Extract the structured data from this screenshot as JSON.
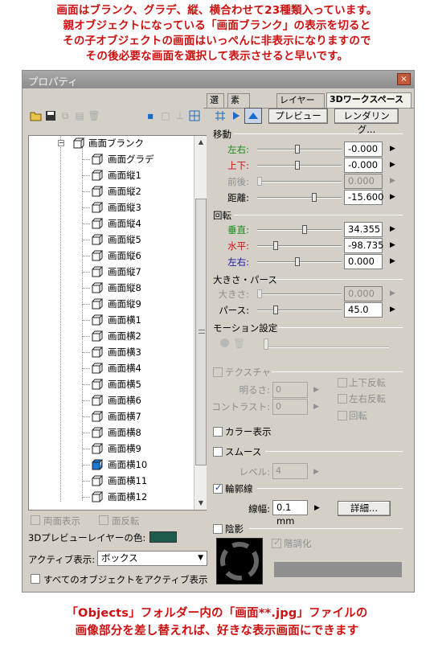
{
  "captions": {
    "top": [
      "画面はブランク、グラデ、縦、横合わせて23種類入っています。",
      "親オブジェクトになっている「画面ブランク」の表示を切ると",
      "その子オブジェクトの画面はいっぺんに非表示になりますので",
      "その後必要な画面を選択して表示させると早いです。"
    ],
    "bottom": [
      "「Objects」フォルダー内の「画面**.jpg」ファイルの",
      "画像部分を差し替えれば、好きな表示画面にできます"
    ]
  },
  "window": {
    "title": "プロパティ",
    "close": "×"
  },
  "tabs": {
    "t1": "選",
    "t2": "素",
    "t3": "レイヤー",
    "t4": "3Dワークスペース"
  },
  "buttons": {
    "preview": "プレビュー",
    "rendering": "レンダリング...",
    "detail": "詳細..."
  },
  "tree": {
    "parent": "画面ブランク",
    "items": [
      "画面グラデ",
      "画面縦1",
      "画面縦2",
      "画面縦3",
      "画面縦4",
      "画面縦5",
      "画面縦6",
      "画面縦7",
      "画面縦8",
      "画面縦9",
      "画面横1",
      "画面横2",
      "画面横3",
      "画面横4",
      "画面横5",
      "画面横6",
      "画面横7",
      "画面横8",
      "画面横9",
      "画面横10",
      "画面横11",
      "画面横12"
    ],
    "selected_index": 19
  },
  "left_bottom": {
    "double_sided": "両面表示",
    "face_flip": "面反転",
    "layer_color_label": "3Dプレビューレイヤーの色:",
    "layer_color": "#1d5a4a",
    "active_display_label": "アクティブ表示:",
    "active_display_value": "ボックス",
    "all_active": "すべてのオブジェクトをアクティブ表示"
  },
  "move": {
    "title": "移動",
    "x_label": "左右:",
    "x_value": "-0.000",
    "y_label": "上下:",
    "y_value": "-0.000",
    "z_label": "前後:",
    "z_value": "0.000",
    "dist_label": "距離:",
    "dist_value": "-15.600"
  },
  "rotate": {
    "title": "回転",
    "v_label": "垂直:",
    "v_value": "34.355",
    "h_label": "水平:",
    "h_value": "-98.735",
    "r_label": "左右:",
    "r_value": "0.000"
  },
  "size": {
    "title": "大きさ・パース",
    "size_label": "大きさ:",
    "size_value": "0.000",
    "pers_label": "パース:",
    "pers_value": "45.0"
  },
  "motion": {
    "title": "モーション設定"
  },
  "texture": {
    "title": "テクスチャ",
    "bright_label": "明るさ:",
    "bright_value": "0",
    "contrast_label": "コントラスト:",
    "contrast_value": "0",
    "flip_v": "上下反転",
    "flip_h": "左右反転",
    "rotate": "回転"
  },
  "cartoon": "カラー表示",
  "smooth": {
    "title": "スムース",
    "level_label": "レベル:",
    "level_value": "4"
  },
  "outline": {
    "title": "輪郭線",
    "width_label": "線幅:",
    "width_value": "0.1 mm"
  },
  "shadow": {
    "title": "陰影",
    "tone": "階調化"
  },
  "colors": {
    "accent_green": "#1a8a1a",
    "accent_red": "#cc1111",
    "accent_blue": "#1a1aa0"
  }
}
